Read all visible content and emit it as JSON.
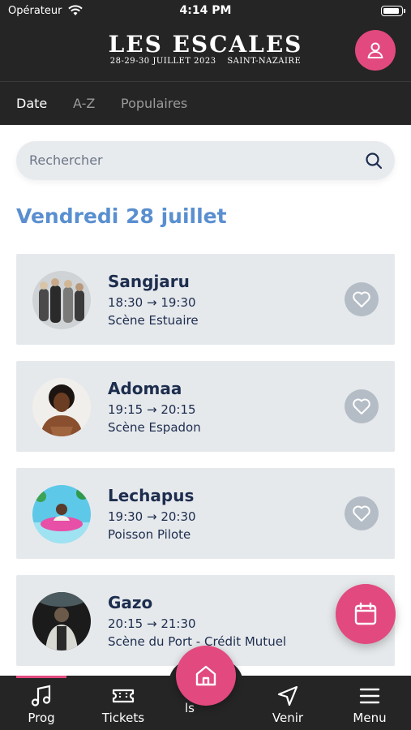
{
  "status_bar": {
    "carrier": "Opérateur",
    "time": "4:14 PM"
  },
  "header": {
    "logo_title": "LES ESCALES",
    "logo_dates": "28-29-30 JUILLET 2023",
    "logo_place": "SAINT-NAZAIRE"
  },
  "tabs": [
    {
      "label": "Date",
      "active": true
    },
    {
      "label": "A-Z",
      "active": false
    },
    {
      "label": "Populaires",
      "active": false
    }
  ],
  "search": {
    "placeholder": "Rechercher"
  },
  "day_title": "Vendredi 28 juillet",
  "events": [
    {
      "artist": "Sangjaru",
      "time": "18:30 → 19:30",
      "stage": "Scène Estuaire"
    },
    {
      "artist": "Adomaa",
      "time": "19:15 → 20:15",
      "stage": "Scène Espadon"
    },
    {
      "artist": "Lechapus",
      "time": "19:30 → 20:30",
      "stage": "Poisson Pilote"
    },
    {
      "artist": "Gazo",
      "time": "20:15 → 21:30",
      "stage": "Scène du Port - Crédit Mutuel"
    }
  ],
  "bottom_nav": {
    "items": [
      {
        "label": "Prog",
        "icon": "music-note-icon",
        "active": true
      },
      {
        "label": "Tickets",
        "icon": "ticket-icon",
        "active": false
      },
      {
        "label": "Venir",
        "icon": "navigation-arrow-icon",
        "active": false
      },
      {
        "label": "Menu",
        "icon": "hamburger-menu-icon",
        "active": false
      }
    ],
    "home_label_fragment": "ls"
  },
  "colors": {
    "accent": "#e2497e",
    "dark": "#252525",
    "heading_blue": "#5a8fd0",
    "text_navy": "#1d2d4e",
    "card_bg": "#e6e9ec"
  }
}
